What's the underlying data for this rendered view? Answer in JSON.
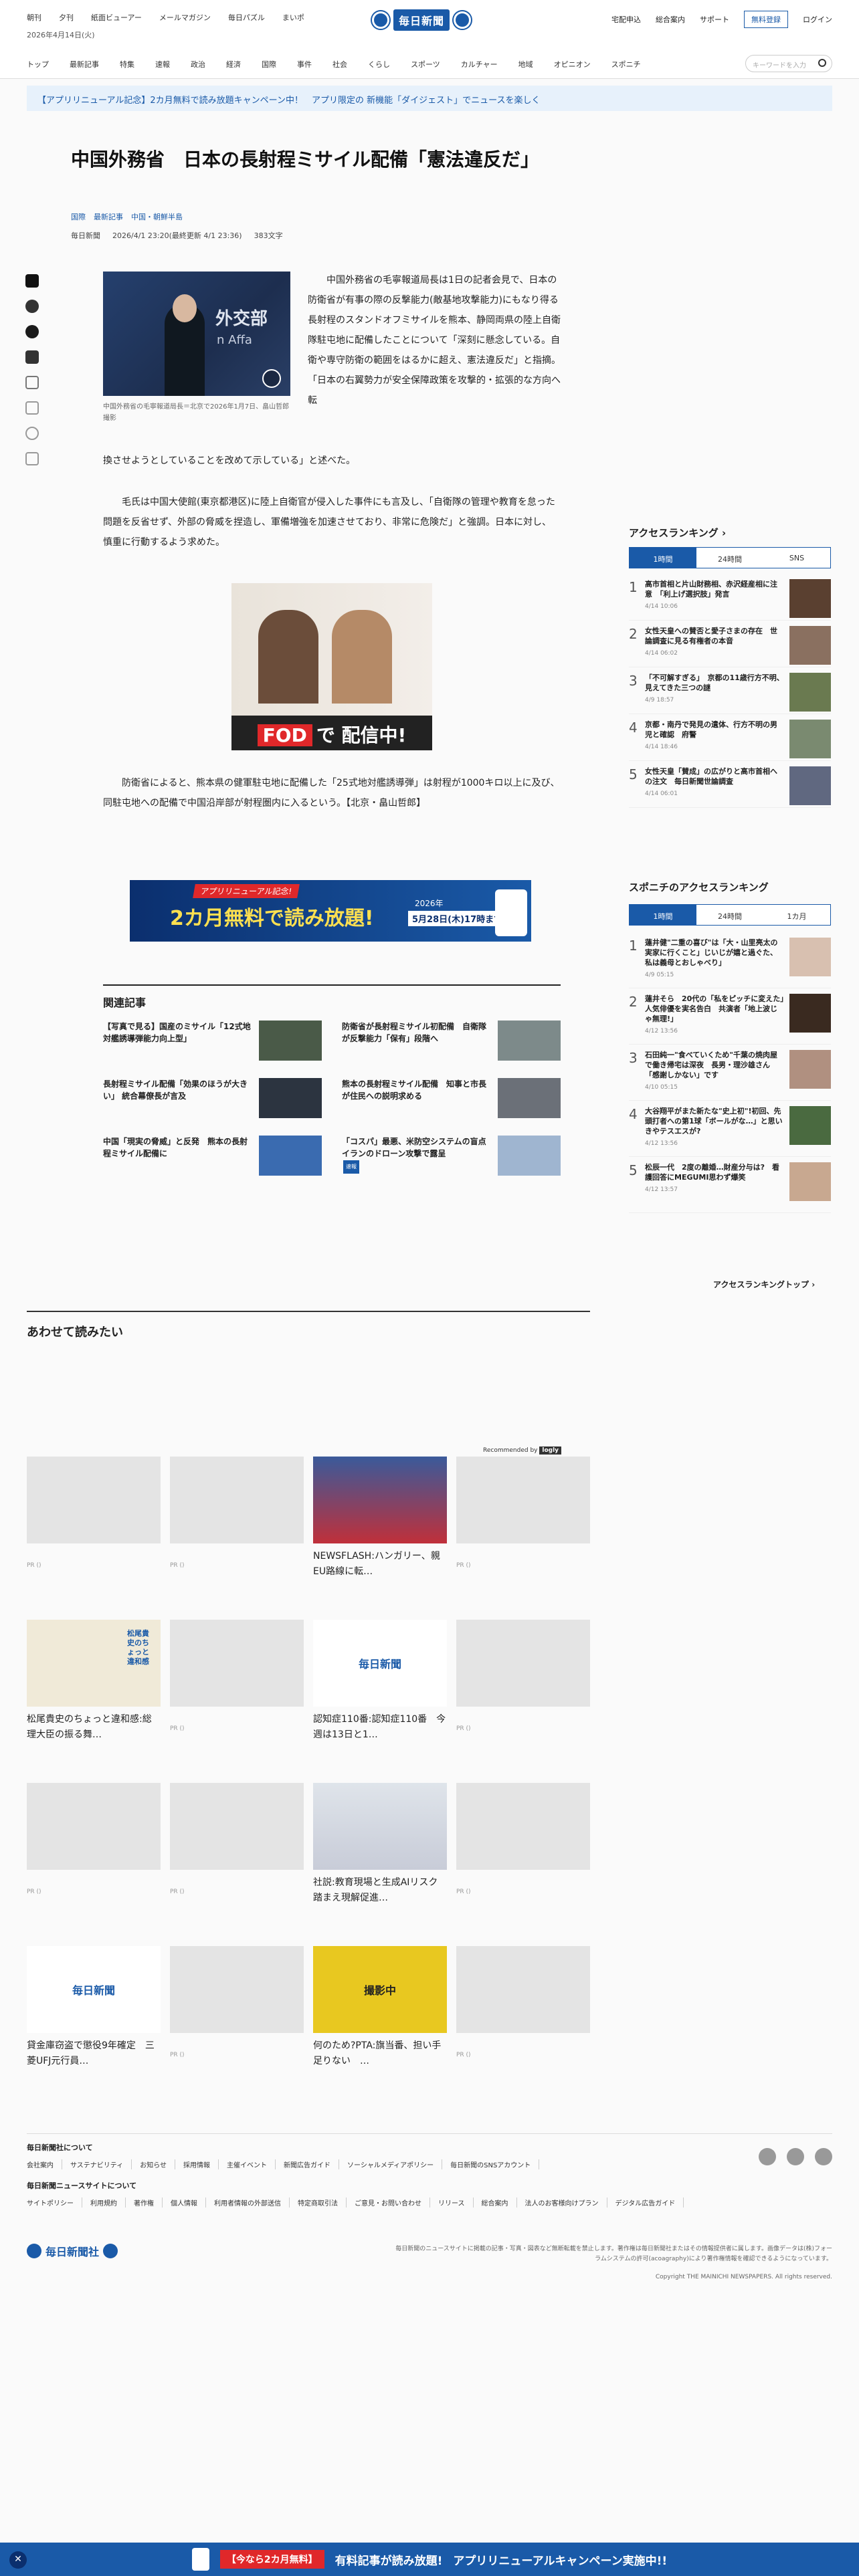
{
  "header": {
    "top_links": [
      "朝刊",
      "夕刊",
      "紙面ビューアー",
      "メールマガジン",
      "毎日パズル",
      "まいポ"
    ],
    "date": "2026年4月14日(火)",
    "logo": "毎日新聞",
    "right_links": [
      "宅配申込",
      "総合案内",
      "サポート"
    ],
    "register": "無料登録",
    "login": "ログイン",
    "nav": [
      "トップ",
      "最新記事",
      "特集",
      "速報",
      "政治",
      "経済",
      "国際",
      "事件",
      "社会",
      "くらし",
      "スポーツ",
      "カルチャー",
      "地域",
      "オピニオン",
      "スポニチ"
    ],
    "search_placeholder": "キーワードを入力"
  },
  "promo": "【アプリリニューアル記念】2カ月無料で読み放題キャンペーン中！　アプリ限定の 新機能「ダイジェスト」でニュースを楽しく",
  "article": {
    "title": "中国外務省　日本の長射程ミサイル配備「憲法違反だ」",
    "categories": [
      "国際",
      "最新記事",
      "中国・朝鮮半島"
    ],
    "source": "毎日新聞",
    "date": "2026/4/1 23:20(最終更新 4/1 23:36)",
    "chars": "383文字",
    "photo_sign": "外交部",
    "photo_sign2": "n Affa",
    "caption": "中国外務省の毛寧報道局長＝北京で2026年1月7日、畠山哲郎撮影",
    "p1": "中国外務省の毛寧報道局長は1日の記者会見で、日本の防衛省が有事の際の反撃能力(敵基地攻撃能力)にもなり得る長射程のスタンドオフミサイルを熊本、静岡両県の陸上自衛隊駐屯地に配備したことについて「深刻に懸念している。自衛や専守防衛の範囲をはるかに超え、憲法違反だ」と指摘。「日本の右翼勢力が安全保障政策を攻撃的・拡張的な方向へ転",
    "p1b": "換させようとしていることを改めて示している」と述べた。",
    "p2": "毛氏は中国大使館(東京都港区)に陸上自衛官が侵入した事件にも言及し、「自衛隊の管理や教育を怠った問題を反省せず、外部の脅威を捏造し、軍備増強を加速させており、非常に危険だ」と強調。日本に対し、慎重に行動するよう求めた。",
    "p3": "防衛省によると、熊本県の健軍駐屯地に配備した「25式地対艦誘導弾」は射程が1000キロ以上に及び、同駐屯地への配備で中国沿岸部が射程圏内に入るという。【北京・畠山哲郎】",
    "ad_text": "FODで配信中!",
    "ad_fod": "FOD",
    "ad_rest": "で 配信中!",
    "banner_top": "アプリリニューアル記念!",
    "banner_main": "2カ月無料で読み放題!",
    "banner_year": "2026年",
    "banner_deadline": "5月28日(木)17時まで"
  },
  "related_title": "関連記事",
  "related": [
    {
      "title": "【写真で見る】国産のミサイル「12式地対艦誘導弾能力向上型」",
      "badge": ""
    },
    {
      "title": "防衛省が長射程ミサイル初配備　自衛隊が反撃能力「保有」段階へ",
      "badge": ""
    },
    {
      "title": "長射程ミサイル配備「効果のほうが大きい」 統合幕僚長が言及",
      "badge": ""
    },
    {
      "title": "熊本の長射程ミサイル配備　知事と市長が住民への説明求める",
      "badge": ""
    },
    {
      "title": "中国「現実の脅威」と反発　熊本の長射程ミサイル配備に",
      "badge": ""
    },
    {
      "title": "「コスパ」最悪、米防空システムの盲点　イランのドローン攻撃で露呈",
      "badge": "速報"
    }
  ],
  "sidebar": {
    "access_title": "アクセスランキング",
    "tabs1": [
      "1時間",
      "24時間",
      "SNS"
    ],
    "ranking1": [
      {
        "n": "1",
        "title": "高市首相と片山財務相、赤沢経産相に注意　「利上げ選択肢」発言",
        "date": "4/14 10:06"
      },
      {
        "n": "2",
        "title": "女性天皇への賛否と愛子さまの存在　世論調査に見る有権者の本音",
        "date": "4/14 06:02"
      },
      {
        "n": "3",
        "title": "「不可解すぎる」　京都の11歳行方不明、見えてきた三つの謎",
        "date": "4/9 18:57"
      },
      {
        "n": "4",
        "title": "京都・南丹で発見の遺体、行方不明の男児と確認　府警",
        "date": "4/14 18:46"
      },
      {
        "n": "5",
        "title": "女性天皇「賛成」の広がりと高市首相への注文　毎日新聞世論調査",
        "date": "4/14 06:01"
      }
    ],
    "sponichi_title": "スポニチのアクセスランキング",
    "tabs2": [
      "1時間",
      "24時間",
      "1カ月"
    ],
    "ranking2": [
      {
        "n": "1",
        "title": "蓮井健\"二重の喜び\"は「大・山里亮太の実家に行くこと」じいじが嬉と過ぐた、私は義母とおしゃべり」",
        "date": "4/9 05:15"
      },
      {
        "n": "2",
        "title": "蓮井そら　20代の「私をピッチに変えた」人気俳優を実名告白　共演者「地上波じゃ無理!」",
        "date": "4/12 13:56"
      },
      {
        "n": "3",
        "title": "石田純一\"食べていくため\"千葉の焼肉屋で働き帰宅は深夜　長男・理沙雄さん「感謝しかない」です",
        "date": "4/10 05:15"
      },
      {
        "n": "4",
        "title": "大谷翔平がまた新たな\"史上初\"!初回、先頭打者への第1球「ボールがな…」と思いきやテスエスが?",
        "date": "4/12 13:56"
      },
      {
        "n": "5",
        "title": "松辰一代　2度の離婚…財産分与は?　看護回答にMEGUMI思わず爆笑",
        "date": "4/12 13:57"
      }
    ],
    "ranking_top": "アクセスランキングトップ"
  },
  "recommend": {
    "title": "あわせて読みたい",
    "by": "Recommended by",
    "by_brand": "logly",
    "items": [
      {
        "title": "",
        "pr": "PR ()"
      },
      {
        "title": "",
        "pr": "PR ()"
      },
      {
        "title": "NEWSFLASH:ハンガリー、親EU路線に転…",
        "pr": ""
      },
      {
        "title": "",
        "pr": "PR ()"
      },
      {
        "title": "松尾貴史のちょっと違和感:総理大臣の振る舞…",
        "pr": ""
      },
      {
        "title": "",
        "pr": "PR ()"
      },
      {
        "title": "認知症110番:認知症110番　今週は13日と1…",
        "pr": ""
      },
      {
        "title": "",
        "pr": "PR ()"
      },
      {
        "title": "",
        "pr": "PR ()"
      },
      {
        "title": "",
        "pr": "PR ()"
      },
      {
        "title": "社説:教育現場と生成AIリスク踏まえ現解促進…",
        "pr": ""
      },
      {
        "title": "",
        "pr": "PR ()"
      },
      {
        "title": "貸金庫窃盗で懲役9年確定　三菱UFJ元行員…",
        "pr": ""
      },
      {
        "title": "",
        "pr": "PR ()"
      },
      {
        "title": "何のため?PTA:旗当番、担い手足りない　…",
        "pr": ""
      },
      {
        "title": "",
        "pr": "PR ()"
      }
    ],
    "logo_text": "毎日新聞",
    "illust_text": "松尾貴史のちょっと違和感",
    "sign_text": "撮影中"
  },
  "footer": {
    "company_title": "毎日新聞社について",
    "company_links": [
      "会社案内",
      "サステナビリティ",
      "お知らせ",
      "採用情報",
      "主催イベント",
      "新聞広告ガイド",
      "ソーシャルメディアポリシー",
      "毎日新聞のSNSアカウント"
    ],
    "site_title": "毎日新聞ニュースサイトについて",
    "site_links": [
      "サイトポリシー",
      "利用規約",
      "著作権",
      "個人情報",
      "利用者情報の外部送信",
      "特定商取引法",
      "ご意見・お問い合わせ",
      "リリース",
      "総合案内",
      "法人のお客様向けプラン",
      "デジタル広告ガイド"
    ],
    "logo": "毎日新聞社",
    "notice": "毎日新聞のニュースサイトに掲載の記事・写真・図表など無断転載を禁止します。著作権は毎日新聞社またはその情報提供者に属します。画像データは(株)フォーラムシステムの許可(acoagraphy)により著作権情報を確認できるようになっています。",
    "copyright": "Copyright THE MAINICHI NEWSPAPERS. All rights reserved."
  },
  "bottom_bar": {
    "close": "✕",
    "free": "【今なら2カ月無料】",
    "text": "有料記事が読み放題!",
    "campaign": "アプリリニューアルキャンペーン実施中!!"
  },
  "colors": {
    "brand": "#1a5aa8",
    "accent": "#e0282a"
  }
}
